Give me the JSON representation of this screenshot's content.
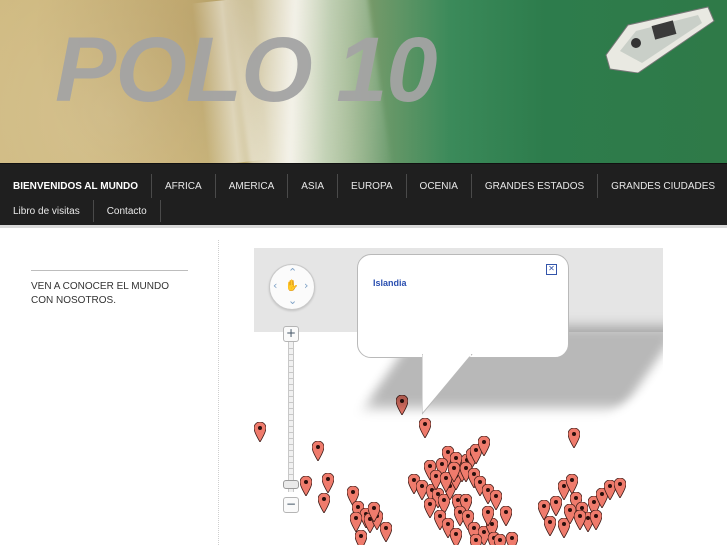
{
  "site": {
    "title": "POLO 10"
  },
  "nav": {
    "row1": [
      {
        "label": "BIENVENIDOS AL MUNDO",
        "active": true
      },
      {
        "label": "AFRICA"
      },
      {
        "label": "AMERICA"
      },
      {
        "label": "ASIA"
      },
      {
        "label": "EUROPA"
      },
      {
        "label": "OCENIA"
      },
      {
        "label": "GRANDES ESTADOS"
      },
      {
        "label": "GRANDES CIUDADES"
      }
    ],
    "row2": [
      {
        "label": "Libro de visitas"
      },
      {
        "label": "Contacto"
      }
    ]
  },
  "sidebar": {
    "text": "VEN A CONOCER EL MUNDO CON NOSOTROS."
  },
  "map": {
    "infowindow": {
      "title": "Islandia",
      "close_glyph": "✕"
    },
    "controls": {
      "zoom_in": "+",
      "zoom_out": "−"
    },
    "marker_color": "#ef7b6c"
  }
}
